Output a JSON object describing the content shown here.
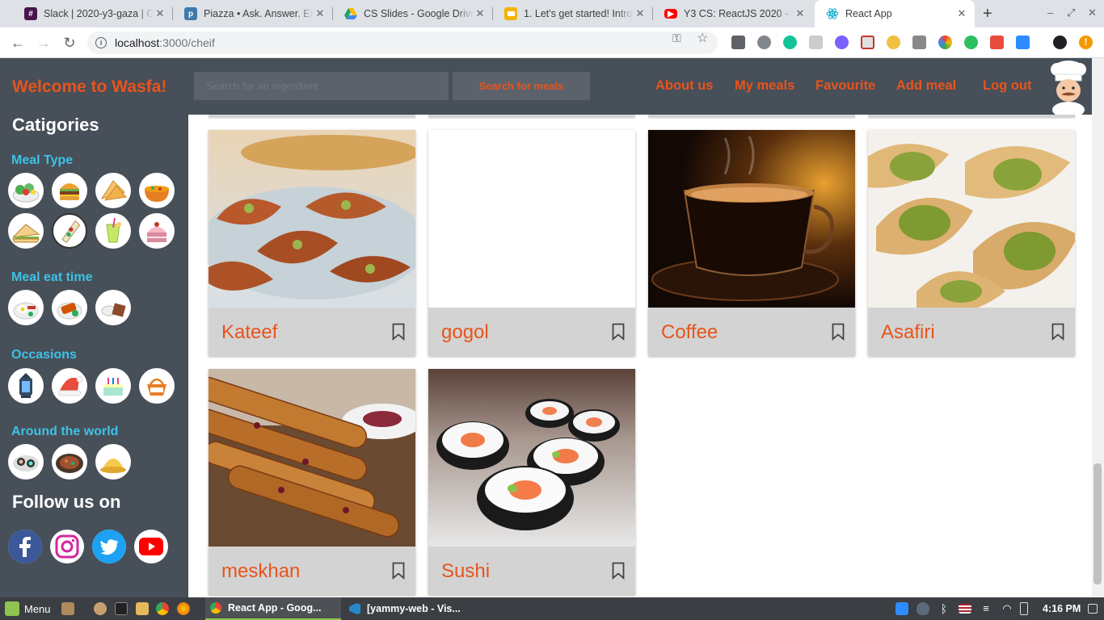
{
  "browser": {
    "tabs": [
      {
        "title": "Slack | 2020-y3-gaza | G",
        "icon": "slack-icon",
        "color": "#4a154b"
      },
      {
        "title": "Piazza • Ask. Answer. Ex",
        "icon": "piazza-icon",
        "color": "#3e7aab"
      },
      {
        "title": "CS Slides - Google Drive",
        "icon": "google-drive-icon",
        "color": "#1fa463"
      },
      {
        "title": "1. Let's get started! Intro",
        "icon": "google-slides-icon",
        "color": "#f4b400"
      },
      {
        "title": "Y3 CS: ReactJS 2020 - Yo",
        "icon": "youtube-icon",
        "color": "#ff0000"
      },
      {
        "title": "React App",
        "icon": "react-icon",
        "color": "#00d8ff"
      }
    ],
    "url_host": "localhost",
    "url_path": ":3000/cheif",
    "new_tab": "+"
  },
  "app": {
    "brand": "Welcome to Wasfa!",
    "search_placeholder": "Search for an ingerdient",
    "search_button": "Search for meals",
    "nav": [
      "About us",
      "My meals",
      "Favourite",
      "Add meal",
      "Log out"
    ],
    "accent": "#e8541c",
    "header_bg": "#474f59",
    "section_color": "#3cc3e6"
  },
  "sidebar": {
    "title": "Catigories",
    "sections": [
      {
        "title": "Meal Type",
        "icons": [
          "salad-icon",
          "burger-icon",
          "sandwich-roll-icon",
          "soup-icon",
          "sandwich-icon",
          "wrap-icon",
          "drink-icon",
          "cake-icon"
        ]
      },
      {
        "title": "Meal eat time",
        "icons": [
          "breakfast-icon",
          "lunch-icon",
          "dinner-icon"
        ]
      },
      {
        "title": "Occasions",
        "icons": [
          "ramadan-lantern-icon",
          "christmas-hat-icon",
          "birthday-cake-icon",
          "eid-basket-icon"
        ]
      },
      {
        "title": "Around the world",
        "icons": [
          "sushi-icon",
          "asian-dish-icon",
          "rice-dish-icon"
        ]
      }
    ],
    "follow_title": "Follow us on",
    "social": [
      "facebook-icon",
      "instagram-icon",
      "twitter-icon",
      "youtube-icon"
    ]
  },
  "meals": [
    {
      "name": "Kateef",
      "image": "kateef-image"
    },
    {
      "name": "gogol",
      "image": ""
    },
    {
      "name": "Coffee",
      "image": "coffee-image"
    },
    {
      "name": "Asafiri",
      "image": "asafiri-image"
    },
    {
      "name": "meskhan",
      "image": "meskhan-image"
    },
    {
      "name": "Sushi",
      "image": "sushi-image"
    }
  ],
  "taskbar": {
    "menu": "Menu",
    "windows": [
      "React App - Goog...",
      "[yammy-web - Vis..."
    ],
    "clock": "4:16 PM"
  }
}
